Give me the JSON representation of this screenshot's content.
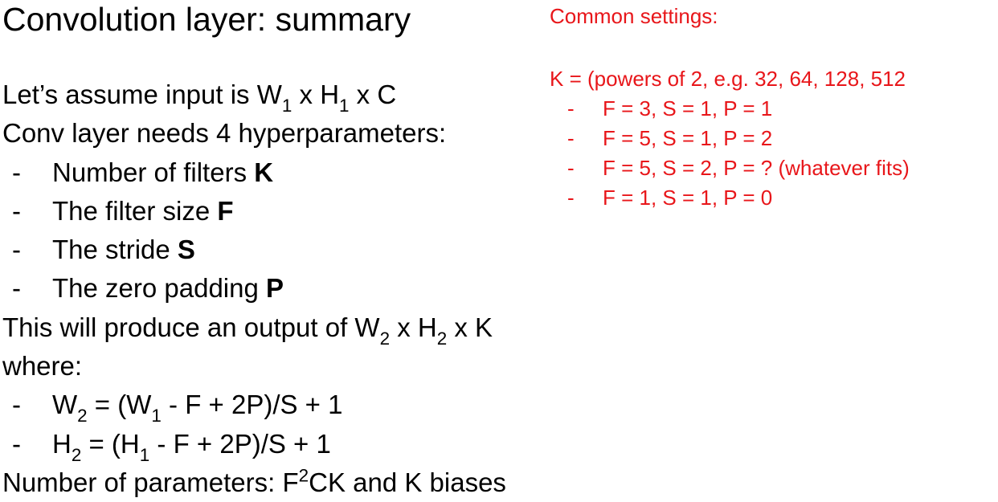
{
  "title": "Convolution layer: summary",
  "left": {
    "input_prefix": "Let’s assume input is W",
    "input_sub1": "1",
    "input_mid": " x H",
    "input_sub2": "1",
    "input_suffix": " x C",
    "needs": "Conv layer needs 4 hyperparameters:",
    "dash": "-",
    "hyperparams": [
      {
        "text": "Number of filters ",
        "sym": "K"
      },
      {
        "text": "The filter size ",
        "sym": "F"
      },
      {
        "text": "The stride ",
        "sym": "S"
      },
      {
        "text": "The zero padding ",
        "sym": "P"
      }
    ],
    "output_prefix": "This will produce an output of W",
    "output_sub1": "2",
    "output_mid": " x H",
    "output_sub2": "2",
    "output_suffix": " x K",
    "where": "where:",
    "formula_w": {
      "a": "W",
      "a_sub": "2",
      "b": " = (W",
      "b_sub": "1",
      "c": " - F + 2P)/S + 1"
    },
    "formula_h": {
      "a": "H",
      "a_sub": "2",
      "b": " = (H",
      "b_sub": "1",
      "c": " - F + 2P)/S + 1"
    },
    "params_prefix": "Number of parameters: F",
    "params_sup": "2",
    "params_suffix": "CK and K biases"
  },
  "right": {
    "title": "Common settings:",
    "k_line": "K = (powers of 2, e.g. 32, 64, 128, 512",
    "dash": "-",
    "settings": [
      "F = 3, S = 1, P = 1",
      "F = 5, S = 1, P = 2",
      "F = 5, S = 2, P = ? (whatever fits)",
      "F = 1, S = 1, P = 0"
    ]
  },
  "colors": {
    "accent": "#e8161a",
    "text": "#000000",
    "background": "#ffffff"
  }
}
